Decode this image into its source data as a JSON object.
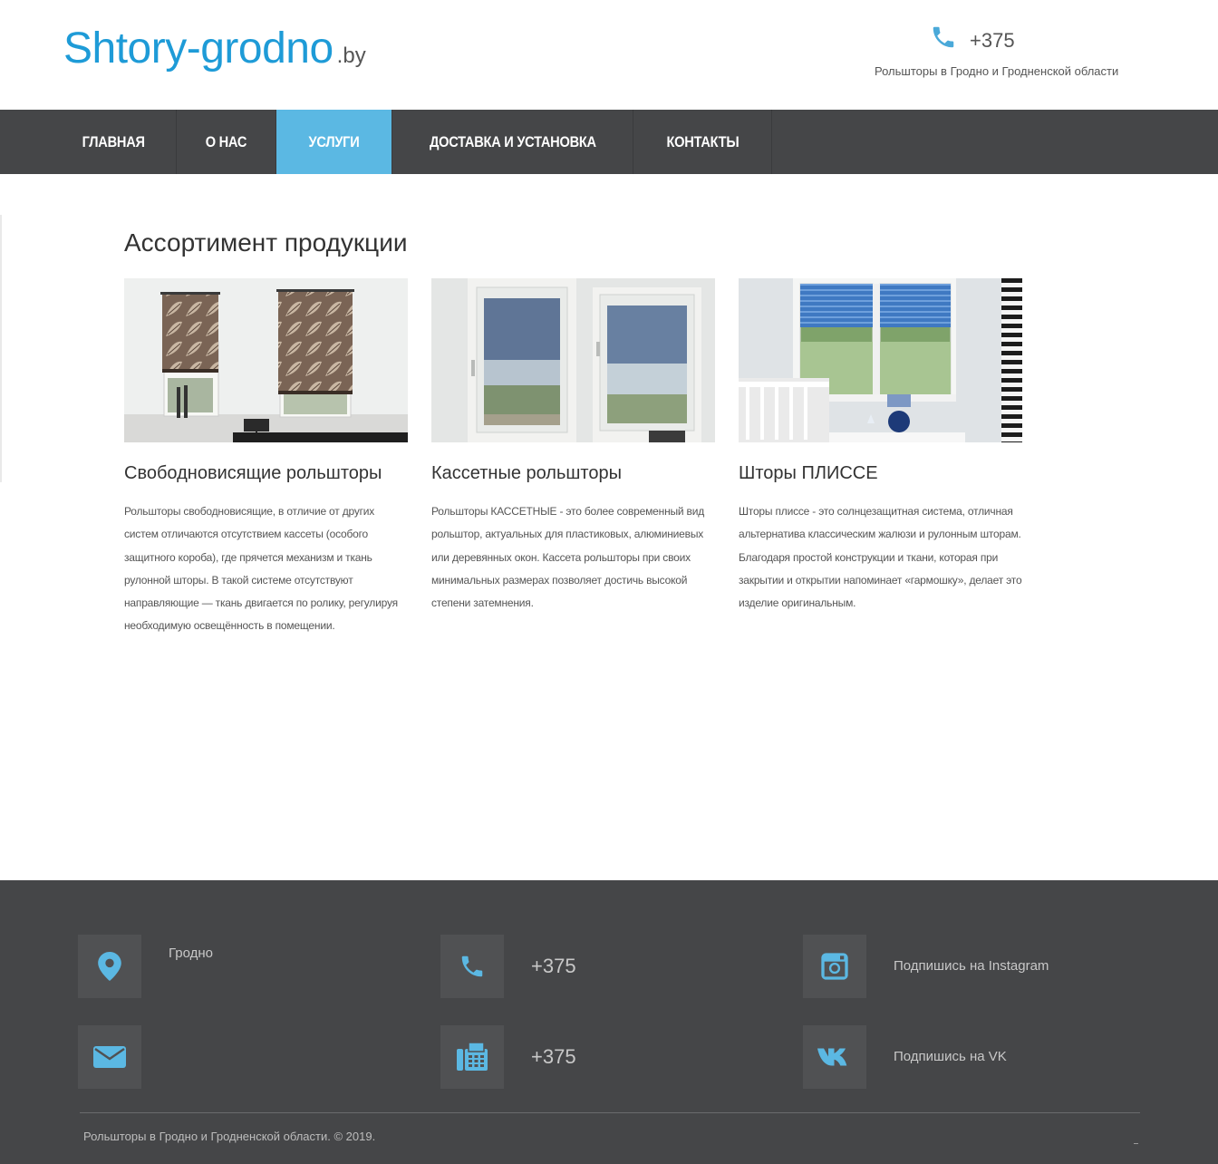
{
  "header": {
    "logo_main": "Shtory-grodno",
    "logo_tld": ".by",
    "phone": "+375",
    "tagline": "Рольшторы в Гродно и Гродненской области",
    "accent_color": "#1e9bd7"
  },
  "nav": {
    "items": [
      {
        "label": "ГЛАВНАЯ",
        "active": false
      },
      {
        "label": "О НАС",
        "active": false
      },
      {
        "label": "УСЛУГИ",
        "active": true
      },
      {
        "label": "ДОСТАВКА И УСТАНОВКА",
        "active": false
      },
      {
        "label": "КОНТАКТЫ",
        "active": false
      }
    ],
    "background": "#454648",
    "active_color": "#5bb8e3"
  },
  "main": {
    "title": "Ассортимент продукции",
    "products": [
      {
        "title": "Свободновисящие рольшторы",
        "text": "Рольшторы свободновисящие, в отличие от других систем отличаются отсутствием кассеты (особого защитного короба), где прячется механизм и ткань рулонной шторы. В такой системе отсутствуют направляющие — ткань двигается по ролику, регулируя необходимую освещённость в помещении."
      },
      {
        "title": "Кассетные рольшторы",
        "text": "Рольшторы КАССЕТНЫЕ - это более современный вид рольштор, актуальных для пластиковых, алюминиевых или деревянных окон. Кассета рольшторы при своих минимальных размерах позволяет достичь высокой степени затемнения."
      },
      {
        "title": "Шторы ПЛИССЕ",
        "text": "Шторы плиссе - это солнцезащитная система, отличная альтернатива классическим жалюзи и рулонным шторам. Благодаря простой конструкции и ткани, которая при закрытии и открытии напоминает «гармошку», делает это изделие оригинальным."
      }
    ]
  },
  "footer": {
    "city": "Гродно",
    "phone": "+375",
    "fax": "+375",
    "instagram": "Подпишись на Instagram",
    "vk": "Подпишись на VK",
    "copyright": "Рольшторы в Гродно и Гродненской области. © 2019.",
    "icons": [
      "map-marker-icon",
      "phone-icon",
      "instagram-icon",
      "envelope-icon",
      "fax-icon",
      "vk-icon"
    ],
    "icon_color": "#5bb8e3"
  }
}
